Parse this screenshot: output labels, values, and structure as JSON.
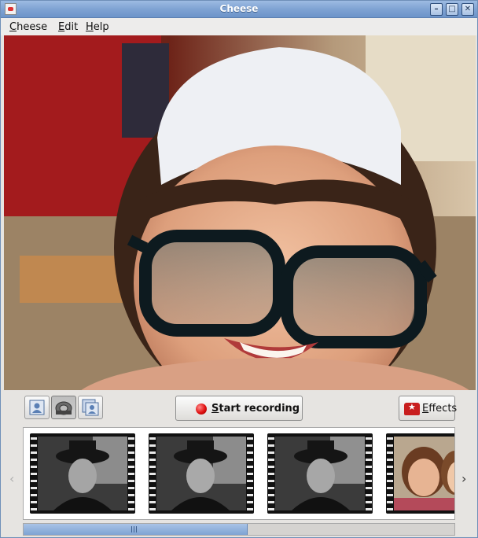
{
  "window": {
    "title": "Cheese"
  },
  "menubar": {
    "items": [
      {
        "label": "Cheese",
        "mnemonic": "C"
      },
      {
        "label": "Edit",
        "mnemonic": "E"
      },
      {
        "label": "Help",
        "mnemonic": "H"
      }
    ]
  },
  "window_controls": {
    "minimize": "minimize-icon",
    "maximize": "maximize-icon",
    "close": "close-icon"
  },
  "toolbar": {
    "modes": [
      {
        "name": "photo-mode",
        "icon": "photo-icon",
        "active": false
      },
      {
        "name": "video-mode",
        "icon": "film-reel-icon",
        "active": true
      },
      {
        "name": "burst-mode",
        "icon": "burst-photo-icon",
        "active": false
      }
    ],
    "record_button": {
      "label": "Start recording",
      "mnemonic": "S",
      "icon": "record-icon"
    },
    "effects_button": {
      "label": "Effects",
      "mnemonic": "E",
      "icon": "effects-icon"
    }
  },
  "filmstrip": {
    "thumbnails": [
      {
        "kind": "video",
        "scene": "man-in-hat-bw"
      },
      {
        "kind": "video",
        "scene": "man-in-hat-bw"
      },
      {
        "kind": "video",
        "scene": "man-in-hat-bw"
      },
      {
        "kind": "video",
        "scene": "children-color"
      }
    ],
    "prev_icon": "chevron-left-icon",
    "next_icon": "chevron-right-icon",
    "scroll_position": 0.0,
    "scroll_visible_fraction": 0.52
  },
  "colors": {
    "titlebar": "#7fa3d3",
    "record": "#e01010",
    "effects_icon": "#c81e1e"
  }
}
